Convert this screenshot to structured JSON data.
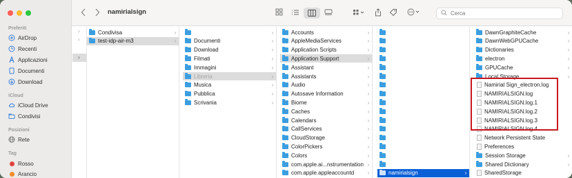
{
  "window": {
    "title": "namirialsign",
    "colors": {
      "accent": "#0a5fd6",
      "highlight_box": "#c8151d",
      "folder": "#3b9ee0"
    }
  },
  "sidebar": {
    "sections": [
      {
        "label": "Preferiti"
      },
      {
        "label": "iCloud"
      },
      {
        "label": "Posizioni"
      },
      {
        "label": "Tag"
      }
    ],
    "favorites": [
      {
        "label": "AirDrop",
        "icon": "airdrop-icon"
      },
      {
        "label": "Recenti",
        "icon": "clock-icon"
      },
      {
        "label": "Applicazioni",
        "icon": "applications-icon"
      },
      {
        "label": "Documenti",
        "icon": "document-icon"
      },
      {
        "label": "Download",
        "icon": "download-icon"
      }
    ],
    "icloud": [
      {
        "label": "iCloud Drive",
        "icon": "cloud-icon"
      },
      {
        "label": "Condivisi",
        "icon": "shared-folder-icon"
      }
    ],
    "locations": [
      {
        "label": "Rete",
        "icon": "network-icon"
      }
    ],
    "tags": [
      {
        "label": "Rosso",
        "color": "#e0443e"
      },
      {
        "label": "Arancio",
        "color": "#f08c2a"
      }
    ]
  },
  "toolbar": {
    "search_placeholder": "Cerca"
  },
  "columns": [
    {
      "rows": [
        {
          "label": "Condivisa",
          "type": "folder",
          "chevron": true
        },
        {
          "label": "test-idp-air-m3",
          "type": "folder",
          "chevron": true,
          "state": "selected"
        }
      ]
    },
    {
      "rows": [
        {
          "label": "",
          "type": "folder",
          "chevron": true
        },
        {
          "label": "Documenti",
          "type": "folder",
          "chevron": true
        },
        {
          "label": "Download",
          "type": "folder",
          "chevron": true
        },
        {
          "label": "Filmati",
          "type": "folder",
          "chevron": true
        },
        {
          "label": "Immagini",
          "type": "folder",
          "chevron": true
        },
        {
          "label": "Libreria",
          "type": "folder",
          "chevron": true,
          "state": "selected-dim"
        },
        {
          "label": "Musica",
          "type": "folder",
          "chevron": true
        },
        {
          "label": "Pubblica",
          "type": "folder",
          "chevron": true
        },
        {
          "label": "Scrivania",
          "type": "folder",
          "chevron": true
        }
      ]
    },
    {
      "rows": [
        {
          "label": "Accounts",
          "type": "folder",
          "chevron": true
        },
        {
          "label": "AppleMediaServices",
          "type": "folder",
          "chevron": true
        },
        {
          "label": "Application Scripts",
          "type": "folder",
          "chevron": true
        },
        {
          "label": "Application Support",
          "type": "folder",
          "chevron": true,
          "state": "selected"
        },
        {
          "label": "Assistant",
          "type": "folder",
          "chevron": true
        },
        {
          "label": "Assistants",
          "type": "folder",
          "chevron": true
        },
        {
          "label": "Audio",
          "type": "folder",
          "chevron": true
        },
        {
          "label": "Autosave Information",
          "type": "folder",
          "chevron": true
        },
        {
          "label": "Biome",
          "type": "folder",
          "chevron": true
        },
        {
          "label": "Caches",
          "type": "folder",
          "chevron": true
        },
        {
          "label": "Calendars",
          "type": "folder",
          "chevron": true
        },
        {
          "label": "CallServices",
          "type": "folder",
          "chevron": true
        },
        {
          "label": "CloudStorage",
          "type": "folder",
          "chevron": true
        },
        {
          "label": "ColorPickers",
          "type": "folder",
          "chevron": true
        },
        {
          "label": "Colors",
          "type": "folder",
          "chevron": true
        },
        {
          "label": "com.apple.ai...nstrumentation",
          "type": "folder",
          "chevron": true
        },
        {
          "label": "com.apple.appleaccountd",
          "type": "folder",
          "chevron": true
        }
      ]
    },
    {
      "rows": [
        {
          "label": "",
          "type": "folder",
          "chevron": false
        },
        {
          "label": "",
          "type": "folder",
          "chevron": false
        },
        {
          "label": "",
          "type": "folder",
          "chevron": false
        },
        {
          "label": "",
          "type": "folder",
          "chevron": false
        },
        {
          "label": "",
          "type": "folder",
          "chevron": false
        },
        {
          "label": "",
          "type": "folder",
          "chevron": false
        },
        {
          "label": "",
          "type": "folder",
          "chevron": false
        },
        {
          "label": "",
          "type": "folder",
          "chevron": false
        },
        {
          "label": "",
          "type": "folder",
          "chevron": false
        },
        {
          "label": "",
          "type": "folder",
          "chevron": false
        },
        {
          "label": "",
          "type": "folder",
          "chevron": false
        },
        {
          "label": "",
          "type": "folder",
          "chevron": false
        },
        {
          "label": "",
          "type": "folder",
          "chevron": false
        },
        {
          "label": "",
          "type": "folder",
          "chevron": false
        },
        {
          "label": "",
          "type": "folder",
          "chevron": false
        },
        {
          "label": "",
          "type": "folder",
          "chevron": false
        },
        {
          "label": "namirialsign",
          "type": "folder",
          "chevron": true,
          "state": "active"
        }
      ]
    },
    {
      "rows": [
        {
          "label": "DawnGraphiteCache",
          "type": "folder",
          "chevron": true
        },
        {
          "label": "DawnWebGPUCache",
          "type": "folder",
          "chevron": true
        },
        {
          "label": "Dictionaries",
          "type": "folder",
          "chevron": true
        },
        {
          "label": "electron",
          "type": "folder",
          "chevron": true
        },
        {
          "label": "GPUCache",
          "type": "folder",
          "chevron": true
        },
        {
          "label": "Local Storage",
          "type": "folder",
          "chevron": true
        },
        {
          "label": "Namirial Sign_electron.log",
          "type": "file"
        },
        {
          "label": "NAMIRIALSIGN.log",
          "type": "file"
        },
        {
          "label": "NAMIRIALSIGN.log.1",
          "type": "file"
        },
        {
          "label": "NAMIRIALSIGN.log.2",
          "type": "file"
        },
        {
          "label": "NAMIRIALSIGN.log.3",
          "type": "file"
        },
        {
          "label": "NAMIRIALSIGN.log.4",
          "type": "file"
        },
        {
          "label": "Network Persistent State",
          "type": "file"
        },
        {
          "label": "Preferences",
          "type": "file"
        },
        {
          "label": "Session Storage",
          "type": "folder",
          "chevron": true
        },
        {
          "label": "Shared Dictionary",
          "type": "folder",
          "chevron": true
        },
        {
          "label": "SharedStorage",
          "type": "file"
        }
      ]
    }
  ]
}
